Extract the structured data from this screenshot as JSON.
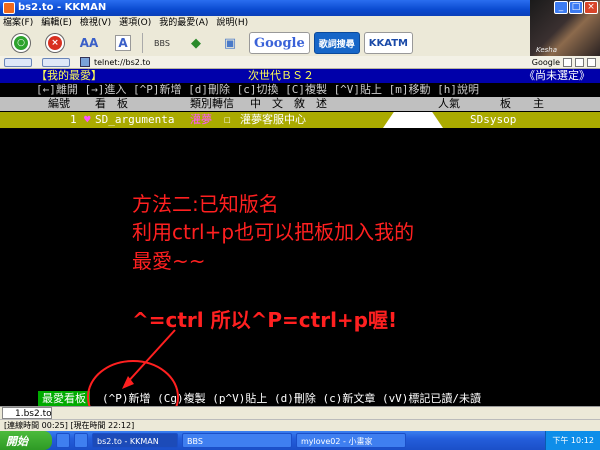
{
  "window": {
    "title": "bs2.to - KKMAN",
    "buttons": [
      "_",
      "□",
      "×"
    ]
  },
  "menubar": [
    "檔案(F)",
    "編輯(E)",
    "檢視(V)",
    "選項(O)",
    "我的最愛(A)",
    "說明(H)"
  ],
  "toolbar": {
    "google_label": "Google",
    "lyrics_label": "歌詞搜尋",
    "kkatm_label": "KKATM",
    "bbs_label": "BBS"
  },
  "banner": {
    "caption": "Kesha"
  },
  "address": {
    "url": "telnet://bs2.to",
    "search_engine": "Google"
  },
  "terminal": {
    "header_left": "【我的最愛】",
    "header_mid": "次世代ＢＳ２",
    "header_right": "《尚未選定》",
    "keys_row": "[←]離開 [→]進入 [^P]新增 [d]刪除 [c]切換 [C]複製 [^V]貼上 [m]移動 [h]說明",
    "columns": {
      "num": "編號",
      "board": "看　板",
      "category": "類別轉信",
      "desc": "中　文　敘　述",
      "pop": "人氣",
      "mod": "板　　主"
    },
    "board_row": {
      "index": "1",
      "name": "SD_argumenta",
      "category": "灌夢",
      "desc": "灌夢客服中心",
      "moderator": "SDsysop"
    },
    "footer_title": "最愛看板",
    "footer_keys": "(^P)新增 (Cg)複製 (p^V)貼上 (d)刪除 (c)新文章 (vV)標記已讀/未讀"
  },
  "annotation": {
    "line1": "方法二:已知版名",
    "line2": "利用ctrl+p也可以把板加入我的",
    "line3": "最愛~~",
    "line4": "^=ctrl  所以^P=ctrl+p喔!"
  },
  "tabs": [
    {
      "label": "1.bs2.to"
    }
  ],
  "status": "[連線時間 00:25] [現在時間 22:12]",
  "taskbar": {
    "start_label": "開始",
    "tasks": [
      "bs2.to - KKMAN",
      "BBS",
      "mylove02 - 小畫家"
    ],
    "clock": "下午 10:12"
  },
  "colors": {
    "annotation": "#ff2020",
    "header_bg": "#0000aa",
    "board_row_bg": "#aaaa00",
    "footer_title_bg": "#00aa00"
  }
}
